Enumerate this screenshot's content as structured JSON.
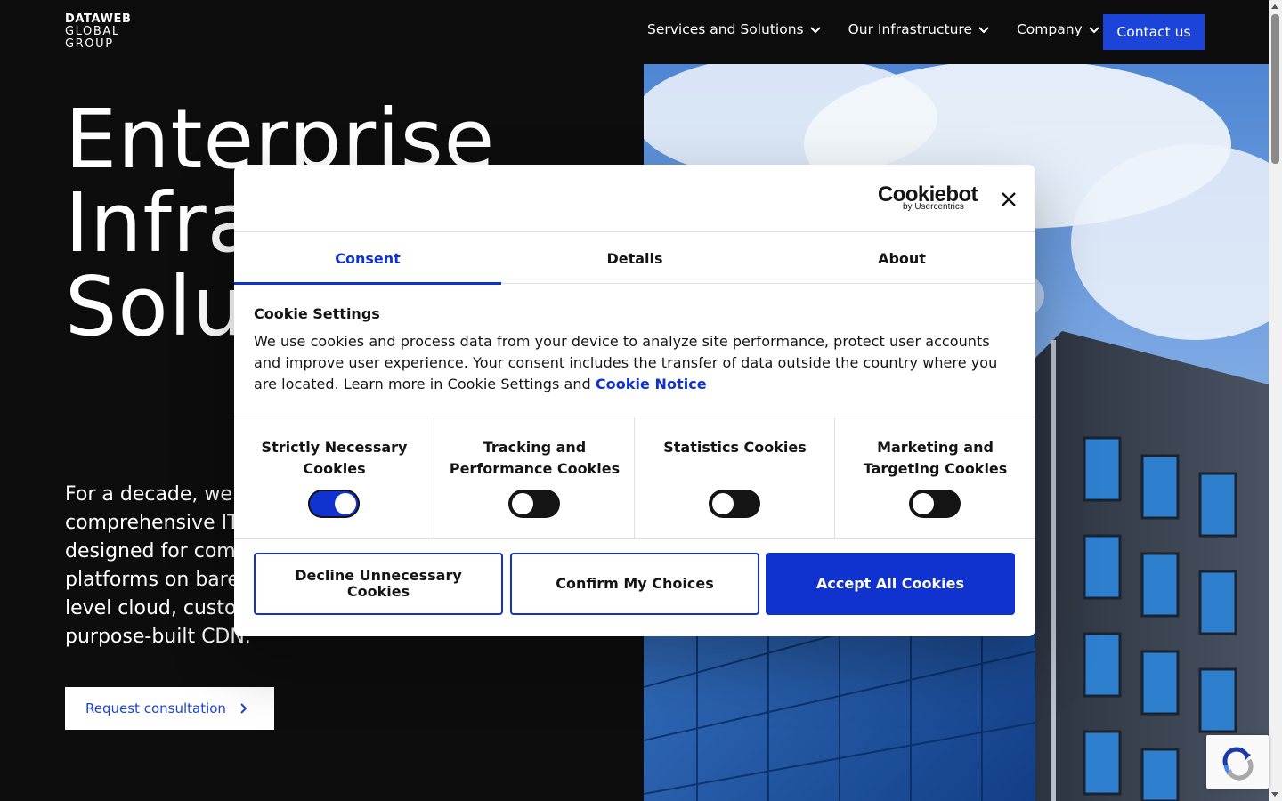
{
  "header": {
    "logo": {
      "line1": "DATAWEB",
      "line2": "GLOBAL",
      "line3": "GROUP"
    },
    "nav": [
      {
        "label": "Services and Solutions"
      },
      {
        "label": "Our Infrastructure"
      },
      {
        "label": "Company"
      }
    ],
    "contact_label": "Contact us"
  },
  "hero": {
    "title_lines": [
      "Enterprise",
      "Infra",
      "Solu"
    ],
    "text_lines": [
      "For a decade, we",
      "comprehensive IT",
      "designed for com",
      "platforms on bare",
      "level cloud, custo",
      "purpose-built CDN."
    ],
    "cta_label": "Request consultation"
  },
  "cookie_dialog": {
    "brand": {
      "name": "Cookiebot",
      "sub": "by Usercentrics"
    },
    "tabs": [
      {
        "label": "Consent",
        "active": true
      },
      {
        "label": "Details",
        "active": false
      },
      {
        "label": "About",
        "active": false
      }
    ],
    "settings_title": "Cookie Settings",
    "settings_text": "We use cookies and process data from your device to analyze site performance, protect user accounts and improve user experience. Your consent includes the transfer of data outside the country where you are located. Learn more in Cookie Settings and ",
    "settings_link": "Cookie Notice",
    "categories": [
      {
        "label": "Strictly Necessary Cookies",
        "enabled": true
      },
      {
        "label": "Tracking and Performance Cookies",
        "enabled": false
      },
      {
        "label": "Statistics Cookies",
        "enabled": false
      },
      {
        "label": "Marketing and Targeting Cookies",
        "enabled": false
      }
    ],
    "buttons": {
      "decline": "Decline Unnecessary Cookies",
      "confirm": "Confirm My Choices",
      "accept": "Accept All Cookies"
    }
  },
  "colors": {
    "accent": "#1032cf",
    "brand_button": "#1d44d8",
    "background": "#0d0d0d"
  }
}
